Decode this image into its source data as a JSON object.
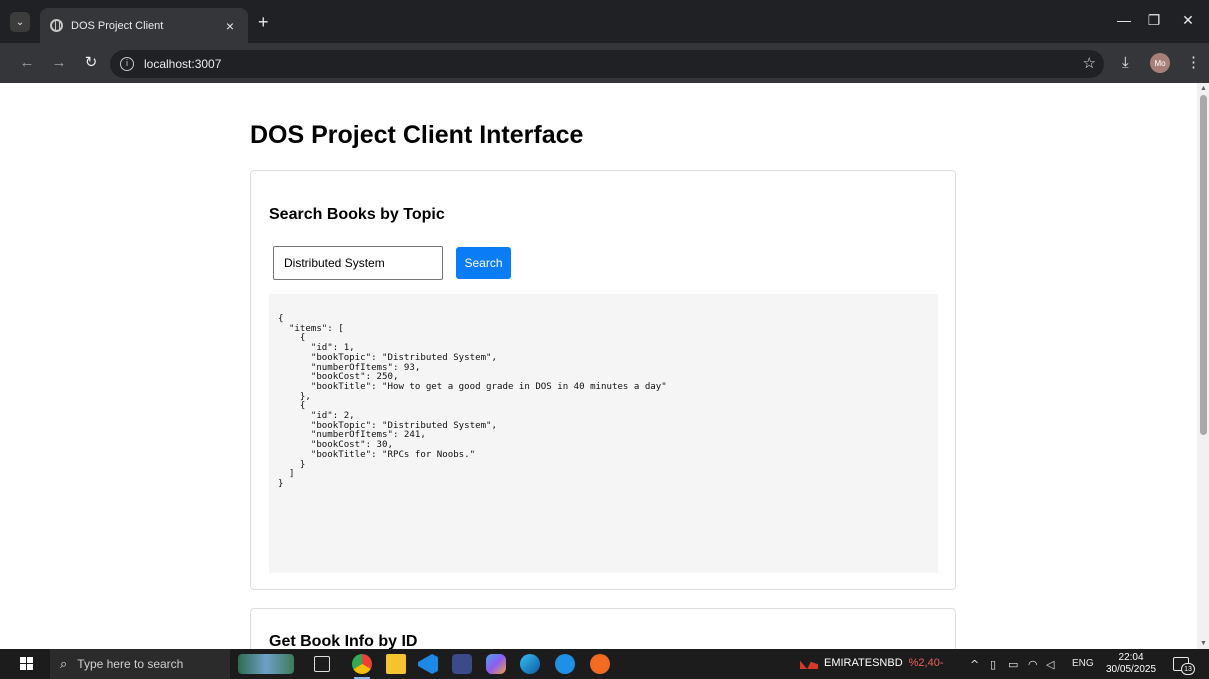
{
  "browser": {
    "tab_title": "DOS Project Client",
    "tab_close": "×",
    "new_tab": "+",
    "url": "localhost:3007",
    "profile_initials": "Mo",
    "controls": {
      "minimize": "—",
      "restore": "❐",
      "close": "✕"
    }
  },
  "page": {
    "title": "DOS Project Client Interface",
    "search_section": {
      "heading": "Search Books by Topic",
      "input_value": "Distributed System",
      "button_label": "Search",
      "result_json": "{\n  \"items\": [\n    {\n      \"id\": 1,\n      \"bookTopic\": \"Distributed System\",\n      \"numberOfItems\": 93,\n      \"bookCost\": 250,\n      \"bookTitle\": \"How to get a good grade in DOS in 40 minutes a day\"\n    },\n    {\n      \"id\": 2,\n      \"bookTopic\": \"Distributed System\",\n      \"numberOfItems\": 241,\n      \"bookCost\": 30,\n      \"bookTitle\": \"RPCs for Noobs.\"\n    }\n  ]\n}"
    },
    "info_section": {
      "heading": "Get Book Info by ID"
    }
  },
  "taskbar": {
    "search_placeholder": "Type here to search",
    "stock_name": "EMIRATESNBD",
    "stock_change": "%2,40-",
    "language": "ENG",
    "time": "22:04",
    "date": "30/05/2025",
    "notification_count": "13",
    "colors": {
      "accent": "#0a7cf5",
      "stock_down": "#f0605a"
    }
  }
}
